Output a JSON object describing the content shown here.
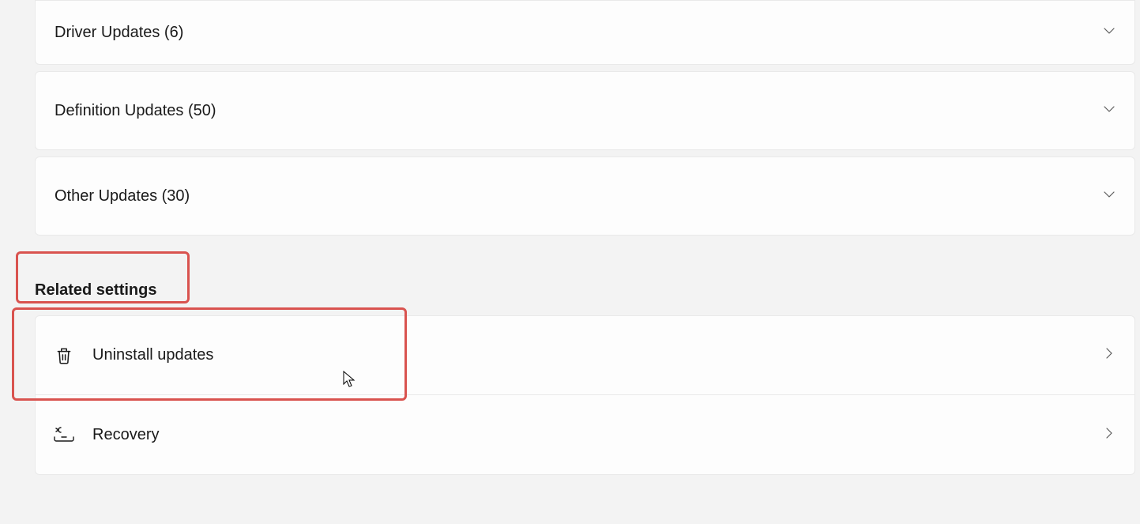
{
  "update_categories": [
    {
      "label": "Driver Updates (6)"
    },
    {
      "label": "Definition Updates (50)"
    },
    {
      "label": "Other Updates (30)"
    }
  ],
  "related_settings": {
    "heading": "Related settings",
    "items": [
      {
        "label": "Uninstall updates",
        "icon": "trash"
      },
      {
        "label": "Recovery",
        "icon": "recovery"
      }
    ]
  }
}
